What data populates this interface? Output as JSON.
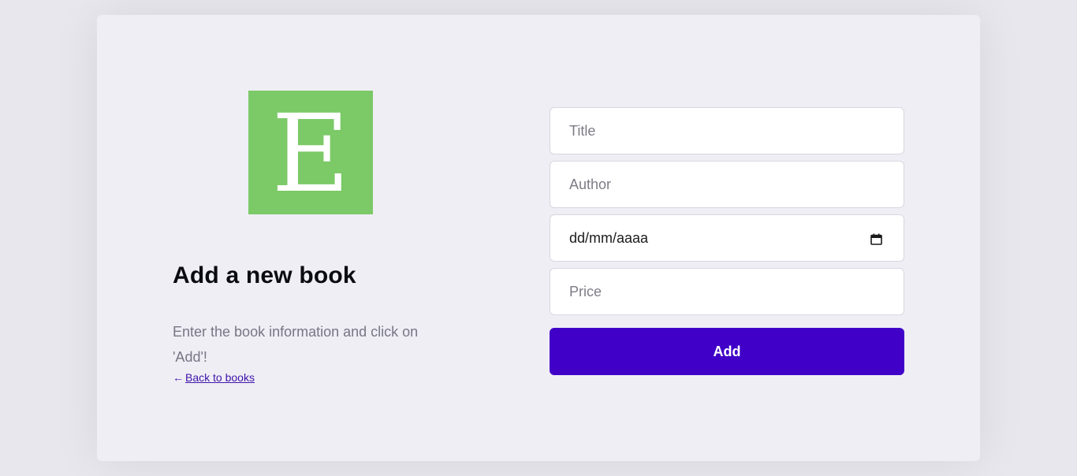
{
  "brand": {
    "logo_letter": "E",
    "logo_color": "#7cc967"
  },
  "intro": {
    "heading": "Add a new book",
    "description": "Enter the book information and click on 'Add'!",
    "back_link": "Back to books"
  },
  "form": {
    "title_placeholder": "Title",
    "author_placeholder": "Author",
    "date_placeholder": "dd/mm/aaaa",
    "price_placeholder": "Price",
    "submit_label": "Add"
  },
  "colors": {
    "accent": "#4000c8",
    "background": "#efeef5",
    "link": "#3f14a8"
  },
  "icons": {
    "back": "arrow-left-icon",
    "date": "calendar-icon"
  }
}
